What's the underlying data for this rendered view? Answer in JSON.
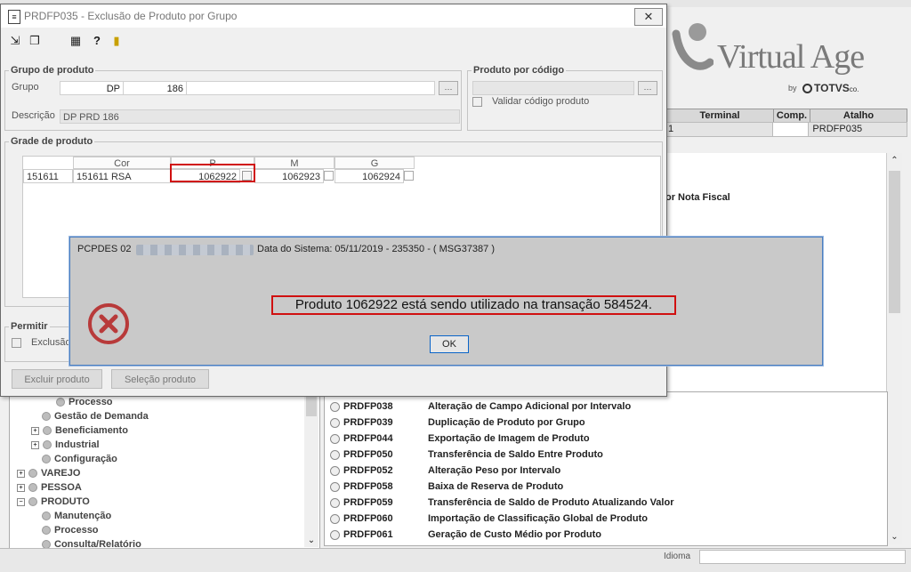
{
  "background": {
    "logo": {
      "brand": "Virtual Age",
      "by": "by",
      "totvs": "TOTVS",
      "totvs_suffix": "co."
    },
    "terminal_table": {
      "headers": [
        "Terminal",
        "Comp.",
        "Atalho"
      ],
      "row": {
        "terminal": "1",
        "comp": "",
        "atalho": "PRDFP035"
      }
    },
    "right_panel_text": "or Nota Fiscal",
    "tree": [
      {
        "label": "Processo",
        "level": 3,
        "expander": false
      },
      {
        "label": "Gestão de Demanda",
        "level": 2,
        "expander": false
      },
      {
        "label": "Beneficiamento",
        "level": 2,
        "expander": true
      },
      {
        "label": "Industrial",
        "level": 2,
        "expander": true
      },
      {
        "label": "Configuração",
        "level": 2,
        "expander": false
      },
      {
        "label": "VAREJO",
        "level": 1,
        "expander": true
      },
      {
        "label": "PESSOA",
        "level": 1,
        "expander": true
      },
      {
        "label": "PRODUTO",
        "level": 1,
        "expander": true
      },
      {
        "label": "Manutenção",
        "level": 2,
        "expander": false
      },
      {
        "label": "Processo",
        "level": 2,
        "expander": false
      },
      {
        "label": "Consulta/Relatório",
        "level": 2,
        "expander": false
      }
    ],
    "programs": [
      {
        "code": "PRDFP038",
        "name": "Alteração de Campo Adicional por Intervalo"
      },
      {
        "code": "PRDFP039",
        "name": "Duplicação de Produto por Grupo"
      },
      {
        "code": "PRDFP044",
        "name": "Exportação de Imagem de Produto"
      },
      {
        "code": "PRDFP050",
        "name": "Transferência de Saldo Entre Produto"
      },
      {
        "code": "PRDFP052",
        "name": "Alteração Peso por Intervalo"
      },
      {
        "code": "PRDFP058",
        "name": "Baixa de Reserva de Produto"
      },
      {
        "code": "PRDFP059",
        "name": "Transferência de Saldo de Produto Atualizando Valor"
      },
      {
        "code": "PRDFP060",
        "name": "Importação de Classificação Global de Produto"
      },
      {
        "code": "PRDFP061",
        "name": "Geração de Custo Médio por Produto"
      }
    ],
    "idioma_label": "Idioma"
  },
  "window": {
    "title": "PRDFP035 - Exclusão de Produto por Grupo",
    "close_glyph": "✕",
    "toolbar_icons": [
      "exit-icon",
      "copy-icon",
      "calculator-icon",
      "help-icon",
      "door-icon"
    ],
    "grupo_produto": {
      "legend": "Grupo de produto",
      "grupo_label": "Grupo",
      "grupo_code": "DP",
      "grupo_num": "186",
      "descricao_label": "Descrição",
      "descricao_value": "DP PRD 186"
    },
    "produto_codigo": {
      "legend": "Produto por código",
      "validar_label": "Validar código produto"
    },
    "grade": {
      "legend": "Grade de produto",
      "headers": {
        "cor": "Cor",
        "p": "P",
        "m": "M",
        "g": "G"
      },
      "row": {
        "cor_code": "151611",
        "cor_name": "151611 RSA",
        "p": "1062922",
        "m": "1062923",
        "g": "1062924"
      }
    },
    "permitir": {
      "legend": "Permitir",
      "exclusao_label": "Exclusão"
    },
    "buttons": {
      "excluir": "Excluir produto",
      "selecao": "Seleção produto"
    }
  },
  "dialog": {
    "title_prefix": "PCPDES 02",
    "title_suffix": "Data do Sistema: 05/11/2019 - 235350 - ( MSG37387 )",
    "message": "Produto 1062922 está sendo utilizado na transação 584524.",
    "ok_label": "OK",
    "error_color": "#b83a3a"
  }
}
